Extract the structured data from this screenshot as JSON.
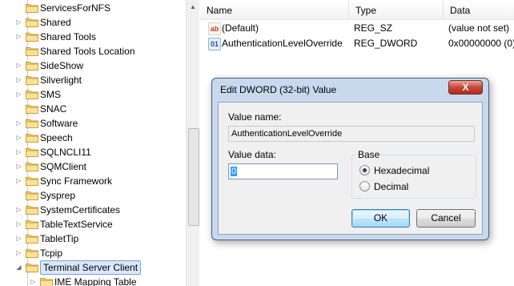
{
  "tree": {
    "items": [
      {
        "label": "ServicesForNFS",
        "expandable": false
      },
      {
        "label": "Shared",
        "expandable": true
      },
      {
        "label": "Shared Tools",
        "expandable": true
      },
      {
        "label": "Shared Tools Location",
        "expandable": false
      },
      {
        "label": "SideShow",
        "expandable": true
      },
      {
        "label": "Silverlight",
        "expandable": true
      },
      {
        "label": "SMS",
        "expandable": true
      },
      {
        "label": "SNAC",
        "expandable": false
      },
      {
        "label": "Software",
        "expandable": true
      },
      {
        "label": "Speech",
        "expandable": true
      },
      {
        "label": "SQLNCLI11",
        "expandable": true
      },
      {
        "label": "SQMClient",
        "expandable": true
      },
      {
        "label": "Sync Framework",
        "expandable": true
      },
      {
        "label": "Sysprep",
        "expandable": false
      },
      {
        "label": "SystemCertificates",
        "expandable": true
      },
      {
        "label": "TableTextService",
        "expandable": true
      },
      {
        "label": "TabletTip",
        "expandable": true
      },
      {
        "label": "Tcpip",
        "expandable": true
      },
      {
        "label": "Terminal Server Client",
        "expandable": true,
        "expanded": true,
        "selected": true
      },
      {
        "label": "IME Mapping Table",
        "expandable": true,
        "child": true
      }
    ]
  },
  "list": {
    "headers": [
      "Name",
      "Type",
      "Data"
    ],
    "rows": [
      {
        "icon": "ab",
        "icon_name": "string-value-icon",
        "name": "(Default)",
        "type": "REG_SZ",
        "data": "(value not set)"
      },
      {
        "icon": "01",
        "icon_name": "binary-value-icon",
        "name": "AuthenticationLevelOverride",
        "type": "REG_DWORD",
        "data": "0x00000000 (0)"
      }
    ]
  },
  "dialog": {
    "title": "Edit DWORD (32-bit) Value",
    "close_label": "X",
    "value_name_label": "Value name:",
    "value_name": "AuthenticationLevelOverride",
    "value_data_label": "Value data:",
    "value_data": "0",
    "base_label": "Base",
    "base_options": [
      {
        "label": "Hexadecimal",
        "checked": true
      },
      {
        "label": "Decimal",
        "checked": false
      }
    ],
    "ok_label": "OK",
    "cancel_label": "Cancel"
  },
  "colors": {
    "selection_bg": "#d9e8fb",
    "dialog_frame": "#c8d9ee",
    "close_button": "#c7463a",
    "text_selection": "#3399ff"
  }
}
